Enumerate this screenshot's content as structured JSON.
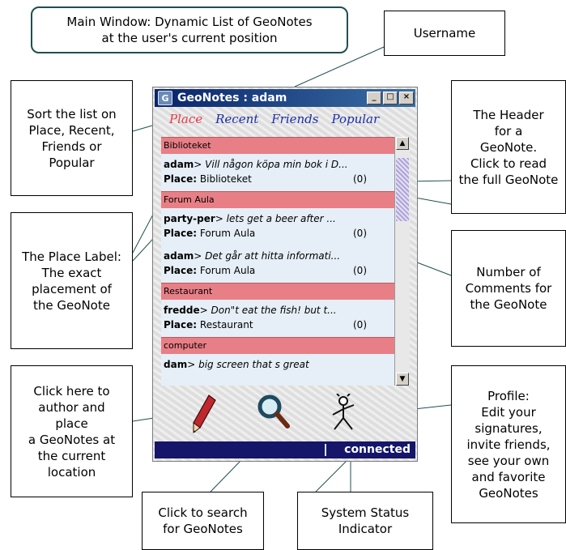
{
  "callouts": {
    "main_window": "Main Window: Dynamic List of GeoNotes\nat the user's current position",
    "username": "Username",
    "sort": "Sort the list on\nPlace, Recent,\nFriends or\nPopular",
    "header": "The Header\nfor a\nGeoNote.\nClick to read\nthe full GeoNote",
    "place_label": "The Place Label:\nThe exact\nplacement of\nthe GeoNote",
    "comments": "Number of\nComments for\nthe GeoNote",
    "author": "Click here to\nauthor and\nplace\na GeoNotes at\nthe current\nlocation",
    "profile": "Profile:\nEdit your\nsignatures,\ninvite friends,\nsee your own\nand favorite\nGeoNotes",
    "search": "Click to search\nfor GeoNotes",
    "status": "System Status\nIndicator"
  },
  "app": {
    "title": "GeoNotes : adam",
    "tabs": [
      "Place",
      "Recent",
      "Friends",
      "Popular"
    ],
    "status": "connected",
    "place_prefix": "Place:",
    "items": [
      {
        "type": "place",
        "label": "Biblioteket"
      },
      {
        "type": "note",
        "user": "adam",
        "text": "Vill någon köpa min bok i D...",
        "place": "Biblioteket",
        "comments": "(0)"
      },
      {
        "type": "place",
        "label": "Forum Aula"
      },
      {
        "type": "note",
        "user": "party-per",
        "text": "lets get a beer after ...",
        "place": "Forum Aula",
        "comments": "(0)"
      },
      {
        "type": "note",
        "user": "adam",
        "text": "Det går att hitta informati...",
        "place": "Forum Aula",
        "comments": "(0)"
      },
      {
        "type": "place",
        "label": "Restaurant"
      },
      {
        "type": "note",
        "user": "fredde",
        "text": "Don\"t eat the fish! but t...",
        "place": "Restaurant",
        "comments": "(0)"
      },
      {
        "type": "place",
        "label": "computer"
      },
      {
        "type": "note",
        "user": "dam",
        "text": "big screen that s great",
        "place": "",
        "comments": ""
      }
    ],
    "icons": [
      "pencil-icon",
      "magnifier-icon",
      "profile-figure-icon"
    ],
    "colors": {
      "place_header": "#e87f86",
      "note_bg": "#e6eff7",
      "active_tab": "#e83a4a",
      "tab": "#1b2fa8",
      "statusbar": "#15156a",
      "titlebar": "#0a246a"
    }
  }
}
